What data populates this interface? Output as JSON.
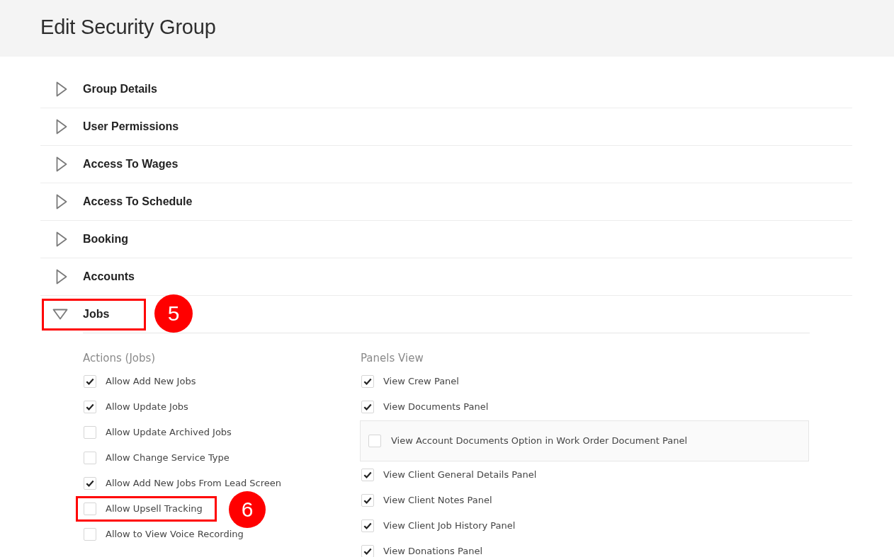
{
  "page": {
    "title": "Edit Security Group"
  },
  "sections": [
    {
      "title": "Group Details",
      "expanded": false
    },
    {
      "title": "User Permissions",
      "expanded": false
    },
    {
      "title": "Access To Wages",
      "expanded": false
    },
    {
      "title": "Access To Schedule",
      "expanded": false
    },
    {
      "title": "Booking",
      "expanded": false
    },
    {
      "title": "Accounts",
      "expanded": false
    },
    {
      "title": "Jobs",
      "expanded": true,
      "callout": "5",
      "groups": [
        {
          "heading": "Actions (Jobs)",
          "options": [
            {
              "label": "Allow Add New Jobs",
              "checked": true,
              "kind": "plain"
            },
            {
              "label": "Allow Update Jobs",
              "checked": true,
              "kind": "plain"
            },
            {
              "label": "Allow Update Archived Jobs",
              "checked": false,
              "kind": "plain"
            },
            {
              "label": "Allow Change Service Type",
              "checked": false,
              "kind": "plain"
            },
            {
              "label": "Allow Add New Jobs From Lead Screen",
              "checked": true,
              "kind": "plain"
            },
            {
              "label": "Allow Upsell Tracking",
              "checked": false,
              "kind": "plain",
              "callout": "6"
            },
            {
              "label": "Allow to View Voice Recording",
              "checked": false,
              "kind": "plain"
            }
          ]
        },
        {
          "heading": "Panels View",
          "options": [
            {
              "label": "View Crew Panel",
              "checked": true,
              "kind": "plain"
            },
            {
              "label": "View Documents Panel",
              "checked": true,
              "kind": "plain"
            },
            {
              "label": "View Account Documents Option in Work Order Document Panel",
              "checked": false,
              "kind": "boxed"
            },
            {
              "label": "View Client General Details Panel",
              "checked": true,
              "kind": "plain"
            },
            {
              "label": "View Client Notes Panel",
              "checked": true,
              "kind": "plain"
            },
            {
              "label": "View Client Job History Panel",
              "checked": true,
              "kind": "plain"
            },
            {
              "label": "View Donations Panel",
              "checked": true,
              "kind": "plain"
            }
          ]
        }
      ]
    }
  ]
}
